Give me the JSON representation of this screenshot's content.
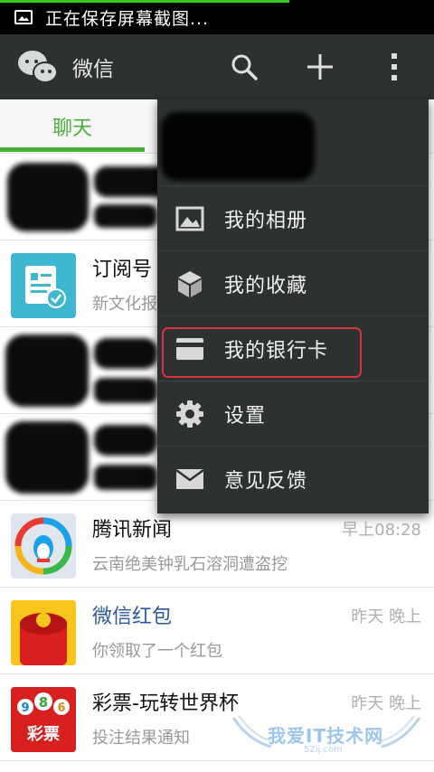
{
  "status_bar": {
    "text": "正在保存屏幕截图..."
  },
  "title_bar": {
    "title": "微信"
  },
  "tabs": [
    {
      "label": "聊天",
      "active": true
    }
  ],
  "menu": {
    "items": [
      {
        "label": "我的相册",
        "icon": "photo-album-icon"
      },
      {
        "label": "我的收藏",
        "icon": "favorites-cube-icon"
      },
      {
        "label": "我的银行卡",
        "icon": "bank-card-icon",
        "highlighted": true
      },
      {
        "label": "设置",
        "icon": "gear-icon"
      },
      {
        "label": "意见反馈",
        "icon": "envelope-icon"
      }
    ]
  },
  "chats": [
    {
      "name": "",
      "message": "",
      "time": ""
    },
    {
      "name": "订阅号",
      "message": "新文化报",
      "time": ""
    },
    {
      "name": "",
      "message": "",
      "time": ""
    },
    {
      "name": "",
      "message": "",
      "time": ""
    },
    {
      "name": "腾讯新闻",
      "message": "云南绝美钟乳石溶洞遭盗挖",
      "time": "早上08:28"
    },
    {
      "name": "微信红包",
      "message": "你领取了一个红包",
      "time": "昨天 晚上"
    },
    {
      "name": "彩票-玩转世界杯",
      "message": "投注结果通知",
      "time": "昨天 晚上"
    }
  ],
  "lottery_logo": {
    "digits": [
      "9",
      "8",
      "6"
    ],
    "label": "彩票"
  },
  "watermark": {
    "text": "我爱IT技术网",
    "sub": "52ij.com"
  },
  "colors": {
    "accent": "#45b035",
    "bar": "#2e3132",
    "highlight": "#d7343a"
  }
}
